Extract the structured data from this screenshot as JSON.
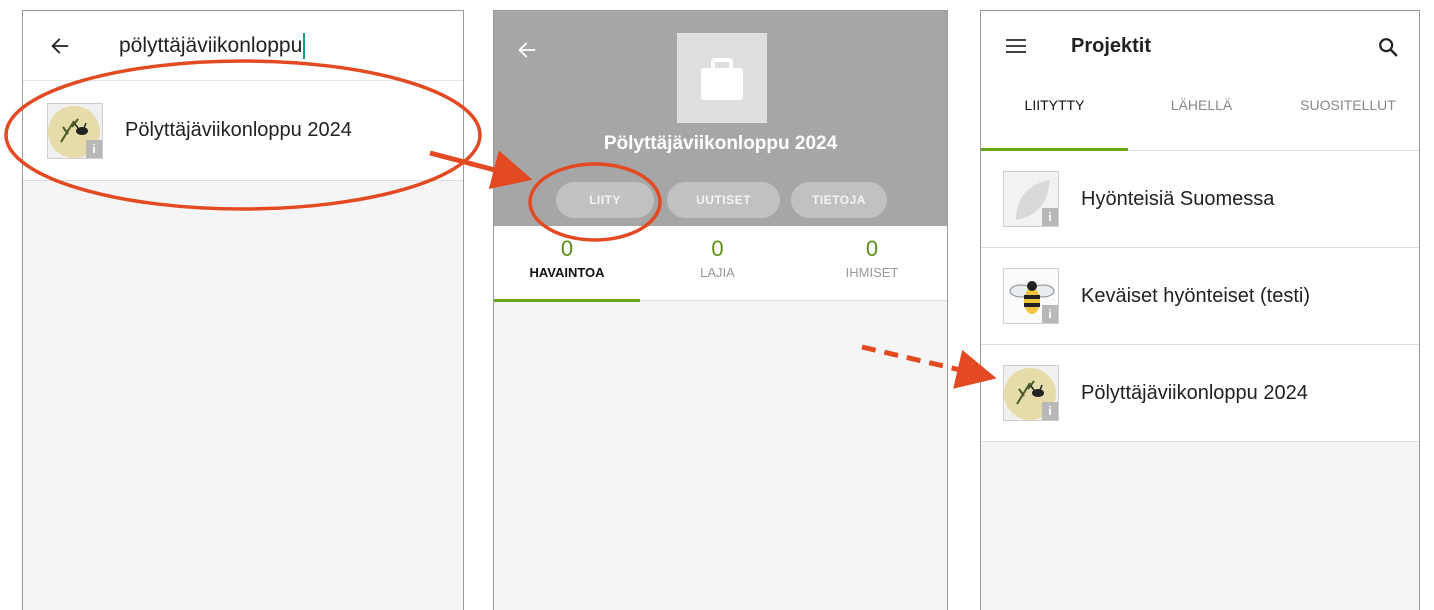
{
  "search_screen": {
    "query": "pölyttäjäviikonloppu",
    "results": [
      {
        "label": "Pölyttäjäviikonloppu 2024",
        "icon": "pollinator-project-thumbnail",
        "info_badge": "i"
      }
    ]
  },
  "project_screen": {
    "title": "Pölyttäjäviikonloppu 2024",
    "actions": {
      "join": "LIITY",
      "news": "UUTISET",
      "info": "TIETOJA"
    },
    "stats": [
      {
        "value": "0",
        "label": "HAVAINTOA"
      },
      {
        "value": "0",
        "label": "LAJIA"
      },
      {
        "value": "0",
        "label": "IHMISET"
      }
    ]
  },
  "projects_screen": {
    "title": "Projektit",
    "tabs": [
      "LIITYTTY",
      "LÄHELLÄ",
      "SUOSITELLUT"
    ],
    "items": [
      {
        "label": "Hyönteisiä Suomessa",
        "icon": "leaf-placeholder-thumbnail",
        "info_badge": "i"
      },
      {
        "label": "Keväiset hyönteiset (testi)",
        "icon": "bee-test-thumbnail",
        "info_badge": "i"
      },
      {
        "label": "Pölyttäjäviikonloppu 2024",
        "icon": "pollinator-project-thumbnail",
        "info_badge": "i"
      }
    ]
  },
  "colors": {
    "accent_green": "#6aa520",
    "stat_number_green": "#5a8e14",
    "header_gray": "#a6a6a6",
    "annotation_orange": "#e34a22",
    "cursor_teal": "#12a07e"
  }
}
